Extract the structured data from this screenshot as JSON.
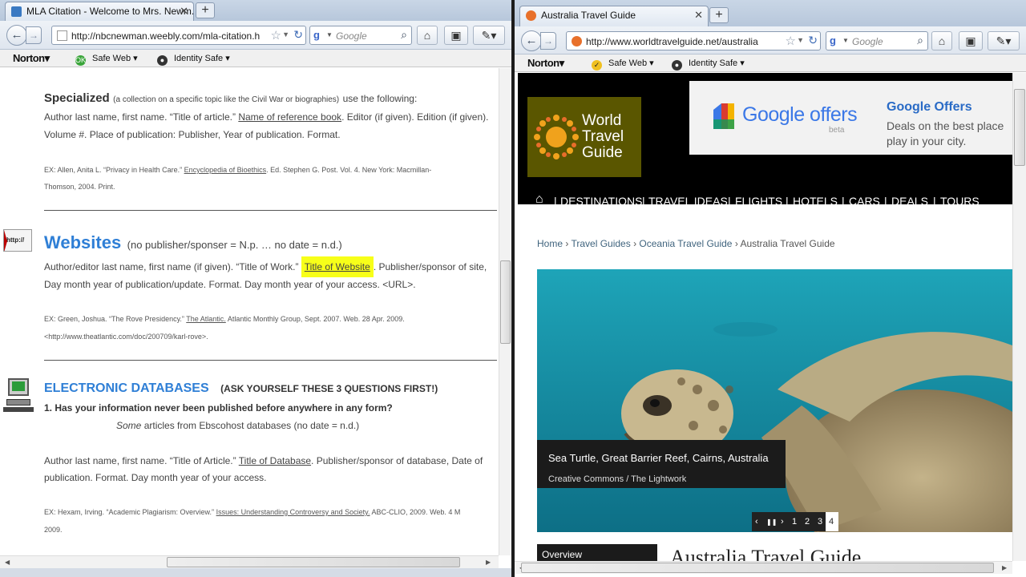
{
  "left": {
    "tab_title": "MLA Citation - Welcome to Mrs. Newm...",
    "url": "http://nbcnewman.weebly.com/mla-citation.h",
    "search_placeholder": "Google",
    "norton": {
      "logo": "Norton",
      "safe_web": "Safe Web",
      "identity_safe": "Identity Safe"
    },
    "content": {
      "specialized": {
        "heading": "Specialized",
        "desc": "(a collection on a specific topic like the Civil War or biographies)",
        "desc2": "use the following:",
        "line1_a": "Author last name, first name. “Title of article.”",
        "line1_b": "Name of reference book",
        "line1_c": ". Editor (if given). Edition (if given).",
        "line2": "Volume #. Place of publication: Publisher, Year of publication. Format.",
        "ex1_a": "EX: Allen, Anita L. “Privacy in Health Care.”",
        "ex1_b": "Encyclopedia of Bioethics",
        "ex1_c": ". Ed. Stephen G. Post. Vol. 4. New York: Macmillan-",
        "ex2": "Thomson, 2004. Print."
      },
      "websites": {
        "icon_text": "http://",
        "heading": "Websites",
        "note": "(no publisher/sponser = N.p.  … no date = n.d.)",
        "line1_a": "Author/editor last name, first name (if given). “Title of Work.”",
        "line1_b": "Title of Website",
        "line1_c": ". Publisher/sponsor of site,",
        "line2": "Day month year of publication/update. Format. Day month year of your access. <URL>.",
        "ex1_a": "EX: Green, Joshua. “The Rove Presidency.”",
        "ex1_b": "The Atlantic.",
        "ex1_c": "Atlantic Monthly Group, Sept. 2007. Web. 28 Apr. 2009.",
        "ex2": "<http://www.theatlantic.com/doc/200709/karl-rove>."
      },
      "databases": {
        "heading": "ELECTRONIC DATABASES",
        "note": "(ASK YOURSELF THESE 3 QUESTIONS FIRST!)",
        "q1": "1. Has your information never been published before anywhere in any form?",
        "sub_a": "Some",
        "sub_b": "articles from Ebscohost databases  (no date = n.d.)",
        "line1_a": "Author last name, first name. “Title of Article.”",
        "line1_b": "Title of Database",
        "line1_c": ". Publisher/sponsor of database, Date of",
        "line2": "publication. Format. Day month year of your access.",
        "ex1_a": "EX: Hexam, Irving. “Academic Plagiarism: Overview.”",
        "ex1_b": "Issues: Understanding Controversy and Society.",
        "ex1_c": "ABC-CLIO, 2009. Web. 4 M",
        "ex2": "2009."
      }
    }
  },
  "right": {
    "tab_title": "Australia Travel Guide",
    "url": "http://www.worldtravelguide.net/australia",
    "search_placeholder": "Google",
    "norton": {
      "logo": "Norton",
      "safe_web": "Safe Web",
      "identity_safe": "Identity Safe"
    },
    "logo": {
      "line1": "World",
      "line2": "Travel",
      "line3": "Guide"
    },
    "ad": {
      "brand": "Google offers",
      "beta": "beta",
      "title": "Google Offers",
      "line1": "Deals on the best place",
      "line2": "play in your city."
    },
    "menu": [
      "DESTINATIONS",
      "TRAVEL IDEAS",
      "FLIGHTS",
      "HOTELS",
      "CARS",
      "DEALS",
      "TOURS"
    ],
    "breadcrumbs": [
      "Home",
      "Travel Guides",
      "Oceania Travel Guide",
      "Australia Travel Guide"
    ],
    "breadcrumb_sep": "›",
    "hero": {
      "caption": "Sea Turtle, Great Barrier Reef, Cairns, Australia",
      "credit": "Creative Commons / The Lightwork",
      "pager": {
        "prev": "‹",
        "pause": "❚❚",
        "next": "›",
        "pages": [
          "1",
          "2",
          "3",
          "4"
        ],
        "active": "4"
      }
    },
    "overview_tab": "Overview",
    "page_heading": "Australia Travel Guide"
  },
  "colors": {
    "wtg_orange": "#f0a21c",
    "menu_bg": "#000000",
    "highlight": "#f7ff19",
    "link_blue": "#2f7fd6"
  }
}
